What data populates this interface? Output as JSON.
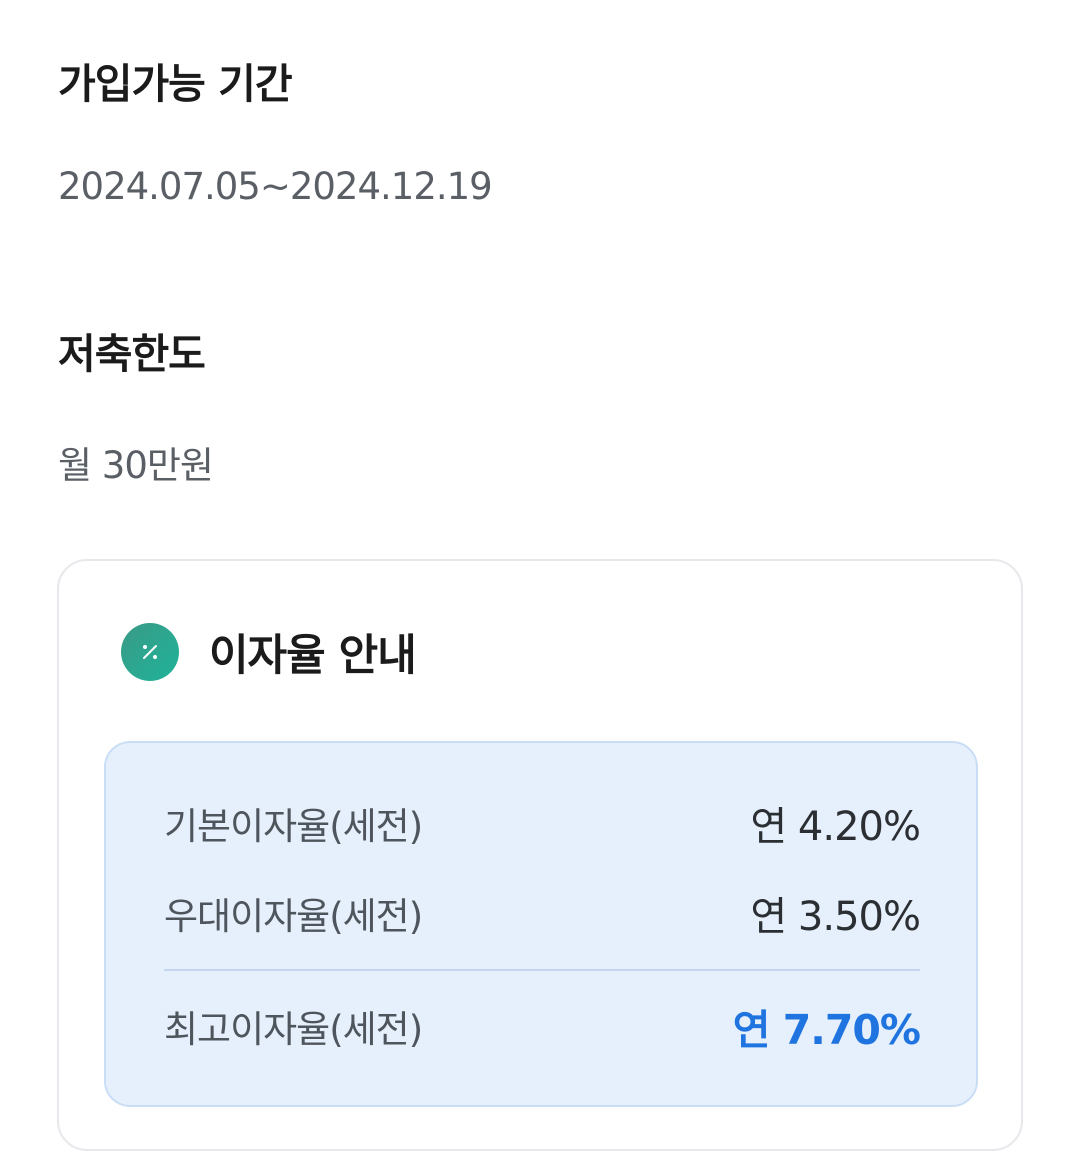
{
  "period": {
    "title": "가입가능 기간",
    "value": "2024.07.05~2024.12.19"
  },
  "limit": {
    "title": "저축한도",
    "value": "월 30만원"
  },
  "interest": {
    "icon": "percent-icon",
    "icon_color": "#2aa88f",
    "title": "이자율 안내",
    "rows": [
      {
        "label": "기본이자율(세전)",
        "value": "연 4.20%"
      },
      {
        "label": "우대이자율(세전)",
        "value": "연 3.50%"
      },
      {
        "label": "최고이자율(세전)",
        "value": "연 7.70%"
      }
    ],
    "highlight_color": "#1f74e0",
    "box_color": "#e6f0fc"
  }
}
